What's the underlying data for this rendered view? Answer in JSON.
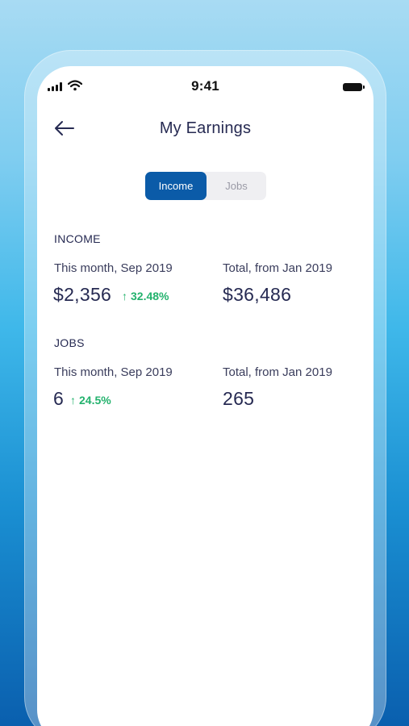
{
  "status_bar": {
    "time": "9:41"
  },
  "header": {
    "title": "My Earnings",
    "back_icon": "arrow-left-icon"
  },
  "tabs": [
    {
      "label": "Income",
      "active": true
    },
    {
      "label": "Jobs",
      "active": false
    }
  ],
  "income": {
    "section_label": "INCOME",
    "month_caption": "This month, Sep 2019",
    "month_value": "$2,356",
    "month_growth": "32.48%",
    "total_caption": "Total, from Jan 2019",
    "total_value": "$36,486"
  },
  "jobs": {
    "section_label": "JOBS",
    "month_caption": "This month, Sep 2019",
    "month_value": "6",
    "month_growth": "24.5%",
    "total_caption": "Total, from Jan 2019",
    "total_value": "265"
  },
  "colors": {
    "accent": "#0b5ba8",
    "growth": "#23b26d",
    "text_primary": "#262a52"
  }
}
